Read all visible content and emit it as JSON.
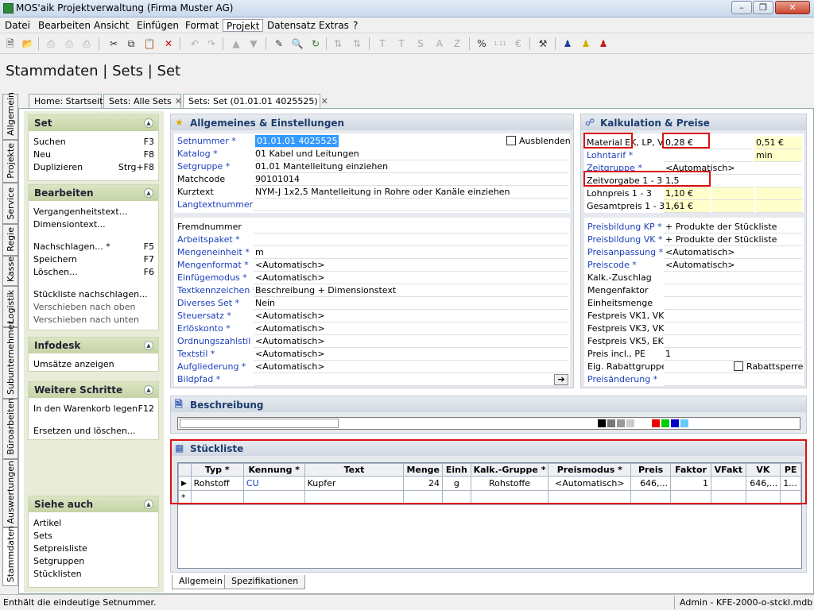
{
  "window": {
    "title": "MOS'aik Projektverwaltung (Firma Muster AG)"
  },
  "menu": [
    "Datei",
    "Bearbeiten",
    "Ansicht",
    "Einfügen",
    "Format",
    "Projekt",
    "Datensatz",
    "Extras",
    "?"
  ],
  "toolbar": {
    "text_format": [
      "T",
      "T",
      "S",
      "A",
      "Z"
    ]
  },
  "page_title": "Stammdaten | Sets | Set",
  "doc_tabs": [
    {
      "label": "Home: Startseite",
      "closable": false
    },
    {
      "label": "Sets: Alle Sets",
      "closable": true
    },
    {
      "label": "Sets: Set (01.01.01 4025525)",
      "closable": true
    }
  ],
  "side_tabs": [
    "Allgemein",
    "Projekte",
    "Service",
    "Regie",
    "Kasse",
    "Logistik",
    "Subunternehmer",
    "Büroarbeiten",
    "Auswertungen",
    "Stammdaten"
  ],
  "left": {
    "set": {
      "title": "Set",
      "items": [
        {
          "label": "Suchen",
          "key": "F3"
        },
        {
          "label": "Neu",
          "key": "F8"
        },
        {
          "label": "Duplizieren",
          "key": "Strg+F8"
        }
      ]
    },
    "bearbeiten": {
      "title": "Bearbeiten",
      "items": [
        {
          "label": "Vergangenheitstext...",
          "key": ""
        },
        {
          "label": "Dimensiontext...",
          "key": ""
        },
        {
          "label": "Nachschlagen... *",
          "key": "F5"
        },
        {
          "label": "Speichern",
          "key": "F7"
        },
        {
          "label": "Löschen...",
          "key": "F6"
        },
        {
          "label": "Stückliste nachschlagen...",
          "key": ""
        },
        {
          "label": "Verschieben nach oben",
          "key": ""
        },
        {
          "label": "Verschieben nach unten",
          "key": ""
        }
      ]
    },
    "infodesk": {
      "title": "Infodesk",
      "items": [
        {
          "label": "Umsätze anzeigen"
        }
      ]
    },
    "weitere": {
      "title": "Weitere Schritte",
      "items": [
        {
          "label": "In den Warenkorb legen",
          "key": "F12"
        },
        {
          "label": "Ersetzen und löschen...",
          "key": ""
        }
      ]
    },
    "siehe": {
      "title": "Siehe auch",
      "items": [
        "Artikel",
        "Sets",
        "Setpreisliste",
        "Setgruppen",
        "Stücklisten"
      ]
    }
  },
  "allgemein": {
    "title": "Allgemeines & Einstellungen",
    "ausblenden": "Ausblenden",
    "fields1": [
      {
        "label": "Setnummer *",
        "value": "01.01.01 4025525",
        "link": true
      },
      {
        "label": "Katalog *",
        "value": "01 Kabel und Leitungen",
        "link": true
      },
      {
        "label": "Setgruppe *",
        "value": "01.01 Mantelleitung einziehen",
        "link": true
      },
      {
        "label": "Matchcode",
        "value": "90101014",
        "link": false
      },
      {
        "label": "Kurztext",
        "value": "NYM-J 1x2,5 Mantelleitung in Rohre oder Kanäle einziehen",
        "link": false
      },
      {
        "label": "Langtextnummer *",
        "value": "",
        "link": true
      }
    ],
    "fields2": [
      {
        "label": "Fremdnummer",
        "value": "",
        "link": false
      },
      {
        "label": "Arbeitspaket *",
        "value": "",
        "link": true
      },
      {
        "label": "Mengeneinheit *",
        "value": "m",
        "link": true
      },
      {
        "label": "Mengenformat *",
        "value": "<Automatisch>",
        "link": true
      },
      {
        "label": "Einfügemodus *",
        "value": "<Automatisch>",
        "link": true
      },
      {
        "label": "Textkennzeichen *",
        "value": "Beschreibung + Dimensionstext",
        "link": true
      },
      {
        "label": "Diverses Set *",
        "value": "Nein",
        "link": true
      },
      {
        "label": "Steuersatz *",
        "value": "<Automatisch>",
        "link": true
      },
      {
        "label": "Erlöskonto *",
        "value": "<Automatisch>",
        "link": true
      },
      {
        "label": "Ordnungszahlstil *",
        "value": "<Automatisch>",
        "link": true
      },
      {
        "label": "Textstil *",
        "value": "<Automatisch>",
        "link": true
      },
      {
        "label": "Aufgliederung *",
        "value": "<Automatisch>",
        "link": true
      },
      {
        "label": "Bildpfad *",
        "value": "",
        "link": true
      }
    ]
  },
  "kalkulation": {
    "title": "Kalkulation & Preise",
    "material_label": "Material EK",
    "lp_vk_label": ", LP, VK",
    "material_ek": "0,28 €",
    "material_vk": "0,51 €",
    "lohntarif_label": "Lohntarif *",
    "lohntarif_unit": "min",
    "zeitgruppe_label": "Zeitgruppe *",
    "zeitgruppe": "<Automatisch>",
    "zeitvorgabe_label": "Zeitvorgabe 1 - 3",
    "zeitvorgabe": "1,5",
    "lohnpreis_label": "Lohnpreis 1 - 3",
    "lohnpreis": "1,10 €",
    "gesamtpreis_label": "Gesamtpreis 1 - 3",
    "gesamtpreis": "1,61 €",
    "fields2": [
      {
        "label": "Preisbildung KP *",
        "value": "+ Produkte der Stückliste",
        "link": true
      },
      {
        "label": "Preisbildung VK *",
        "value": "+ Produkte der Stückliste",
        "link": true
      },
      {
        "label": "Preisanpassung *",
        "value": "<Automatisch>",
        "link": true
      },
      {
        "label": "Preiscode *",
        "value": "<Automatisch>",
        "link": true
      },
      {
        "label": "Kalk.-Zuschlag",
        "value": "",
        "link": false
      },
      {
        "label": "Mengenfaktor",
        "value": "",
        "link": false
      },
      {
        "label": "Einheitsmenge",
        "value": "",
        "link": false
      },
      {
        "label": "Festpreis VK1, VK2",
        "value": "",
        "link": false
      },
      {
        "label": "Festpreis VK3, VK4",
        "value": "",
        "link": false
      },
      {
        "label": "Festpreis VK5, EK",
        "value": "",
        "link": false
      },
      {
        "label": "Preis incl., PE",
        "value": "1",
        "link": false
      },
      {
        "label": "Eig. Rabattgruppe",
        "value": "",
        "link": false
      },
      {
        "label": "Preisänderung *",
        "value": "",
        "link": true
      }
    ],
    "rabattsperre": "Rabattsperre"
  },
  "beschreibung": {
    "title": "Beschreibung"
  },
  "stueckliste": {
    "title": "Stückliste",
    "columns": [
      "Typ *",
      "Kennung *",
      "Text",
      "Menge",
      "Einh",
      "Kalk.-Gruppe *",
      "Preismodus *",
      "Preis",
      "Faktor",
      "VFakt",
      "VK",
      "PE"
    ],
    "rows": [
      [
        "Rohstoff",
        "CU",
        "Kupfer",
        "24",
        "g",
        "Rohstoffe",
        "<Automatisch>",
        "646,...",
        "1",
        "",
        "646,...",
        "1..."
      ]
    ],
    "new_row_marker": "*"
  },
  "bottom_tabs": [
    "Allgemein",
    "Spezifikationen"
  ],
  "status": {
    "left": "Enthält die eindeutige Setnummer.",
    "right": "Admin - KFE-2000-o-stckl.mdb"
  }
}
